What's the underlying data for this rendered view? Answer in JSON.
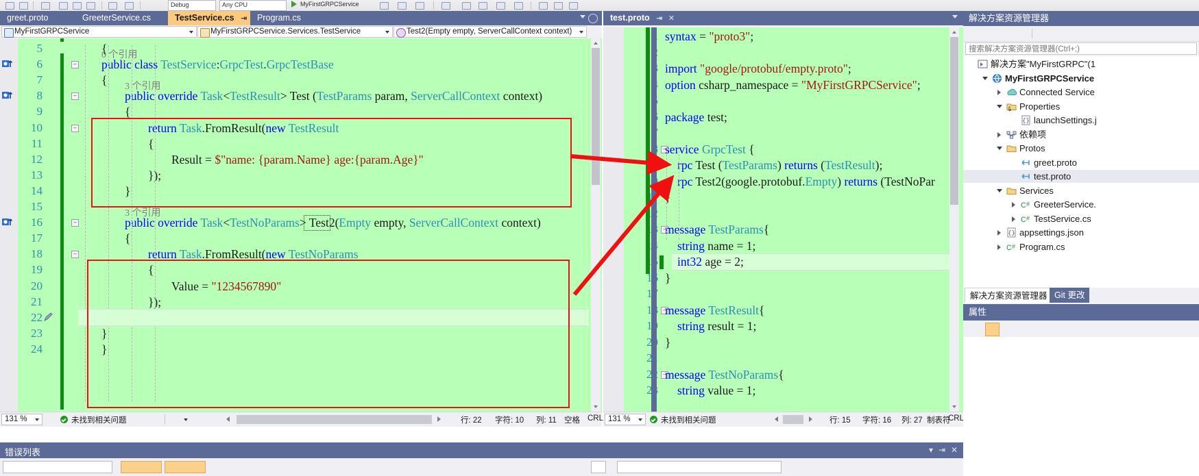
{
  "window": {
    "theme_accent": "#5b6a97",
    "editor_bg": "#b8ffb8"
  },
  "toolbar": {
    "config_value": "Debug",
    "platform_value": "Any CPU",
    "run_label": "MyFirstGRPCService"
  },
  "left_pane": {
    "tabs": [
      {
        "label": "greet.proto",
        "active": false
      },
      {
        "label": "GreeterService.cs",
        "active": false
      },
      {
        "label": "TestService.cs",
        "active": true,
        "pin": "⇥",
        "close": "✕"
      },
      {
        "label": "Program.cs",
        "active": false
      }
    ],
    "navbar": {
      "project": "MyFirstGRPCService",
      "type": "MyFirstGRPCService.Services.TestService",
      "member": "Test2(Empty empty, ServerCallContext context)"
    },
    "code_lines": [
      {
        "n": 5,
        "indent": 1,
        "text": "{"
      },
      {
        "n": 6,
        "indent": 1,
        "text": "public class TestService:GrpcTest.GrpcTestBase",
        "refs": "0 个引用",
        "fold": "-",
        "glyph": true
      },
      {
        "n": 7,
        "indent": 1,
        "text": "{"
      },
      {
        "n": 8,
        "indent": 2,
        "text": "public override Task<TestResult> Test (TestParams param, ServerCallContext context)",
        "refs": "3 个引用",
        "fold": "-",
        "glyph": true
      },
      {
        "n": 9,
        "indent": 2,
        "text": "{"
      },
      {
        "n": 10,
        "indent": 3,
        "text": "return Task.FromResult(new TestResult",
        "fold": "-"
      },
      {
        "n": 11,
        "indent": 3,
        "text": "{"
      },
      {
        "n": 12,
        "indent": 4,
        "text": "Result = $\"name: {param.Name} age:{param.Age}\""
      },
      {
        "n": 13,
        "indent": 3,
        "text": "});"
      },
      {
        "n": 14,
        "indent": 2,
        "text": "}"
      },
      {
        "n": 15,
        "indent": 2,
        "text": ""
      },
      {
        "n": 16,
        "indent": 2,
        "text": "public override Task<TestNoParams> Test2(Empty empty, ServerCallContext context)",
        "refs": "3 个引用",
        "fold": "-",
        "glyph": true
      },
      {
        "n": 17,
        "indent": 2,
        "text": "{"
      },
      {
        "n": 18,
        "indent": 3,
        "text": "return Task.FromResult(new TestNoParams",
        "fold": "-"
      },
      {
        "n": 19,
        "indent": 3,
        "text": "{"
      },
      {
        "n": 20,
        "indent": 4,
        "text": "Value = \"1234567890\""
      },
      {
        "n": 21,
        "indent": 3,
        "text": "});"
      },
      {
        "n": 22,
        "indent": 2,
        "text": "}"
      },
      {
        "n": 23,
        "indent": 1,
        "text": "}"
      },
      {
        "n": 24,
        "indent": 1,
        "text": "}"
      }
    ],
    "status": {
      "zoom": "131 %",
      "problems": "未找到相关问题",
      "line_label": "行: 22",
      "char_label": "字符: 10",
      "col_label": "列: 11",
      "spaces_label": "空格",
      "eol_label": "CRLF"
    }
  },
  "right_pane": {
    "tab": {
      "label": "test.proto",
      "pin": "⇥",
      "close": "✕"
    },
    "code_lines": [
      {
        "n": 1,
        "indent": 0,
        "text": "syntax = \"proto3\";"
      },
      {
        "n": 2,
        "indent": 0,
        "text": ""
      },
      {
        "n": 3,
        "indent": 0,
        "text": "import \"google/protobuf/empty.proto\";"
      },
      {
        "n": 4,
        "indent": 0,
        "text": "option csharp_namespace = \"MyFirstGRPCService\";"
      },
      {
        "n": 5,
        "indent": 0,
        "text": ""
      },
      {
        "n": 6,
        "indent": 0,
        "text": "package test;"
      },
      {
        "n": 7,
        "indent": 0,
        "text": ""
      },
      {
        "n": 8,
        "indent": 0,
        "text": "service GrpcTest {",
        "fold": "-"
      },
      {
        "n": 9,
        "indent": 1,
        "text": "rpc Test (TestParams) returns (TestResult);"
      },
      {
        "n": 10,
        "indent": 1,
        "text": "rpc Test2(google.protobuf.Empty) returns (TestNoPar"
      },
      {
        "n": 11,
        "indent": 0,
        "text": "}"
      },
      {
        "n": 12,
        "indent": 0,
        "text": ""
      },
      {
        "n": 13,
        "indent": 0,
        "text": "message TestParams{",
        "fold": "-"
      },
      {
        "n": 14,
        "indent": 1,
        "text": "string name = 1;"
      },
      {
        "n": 15,
        "indent": 1,
        "text": "int32 age = 2;",
        "current": true
      },
      {
        "n": 16,
        "indent": 0,
        "text": "}"
      },
      {
        "n": 17,
        "indent": 0,
        "text": ""
      },
      {
        "n": 18,
        "indent": 0,
        "text": "message TestResult{",
        "fold": "-"
      },
      {
        "n": 19,
        "indent": 1,
        "text": "string result = 1;"
      },
      {
        "n": 20,
        "indent": 0,
        "text": "}"
      },
      {
        "n": 21,
        "indent": 0,
        "text": ""
      },
      {
        "n": 22,
        "indent": 0,
        "text": "message TestNoParams{",
        "fold": "-"
      },
      {
        "n": 23,
        "indent": 1,
        "text": "string value = 1;"
      }
    ],
    "status": {
      "zoom": "131 %",
      "problems": "未找到相关问题",
      "line_label": "行: 15",
      "char_label": "字符: 16",
      "col_label": "列: 27",
      "tab_label": "制表符",
      "eol_label": "CRLF"
    }
  },
  "solution_explorer": {
    "title": "解决方案资源管理器",
    "search_placeholder": "搜索解决方案资源管理器(Ctrl+;)",
    "tree": [
      {
        "label": "解决方案\"MyFirstGRPC\"(1",
        "depth": 0,
        "icon": "solution-icon",
        "twisty": "none",
        "bold": false,
        "selected": false
      },
      {
        "label": "MyFirstGRPCService",
        "depth": 1,
        "icon": "project-icon",
        "twisty": "open",
        "bold": true,
        "selected": false
      },
      {
        "label": "Connected Service",
        "depth": 2,
        "icon": "connected-icon",
        "twisty": "closed",
        "bold": false,
        "selected": false
      },
      {
        "label": "Properties",
        "depth": 2,
        "icon": "folder-props-icon",
        "twisty": "open",
        "bold": false,
        "selected": false
      },
      {
        "label": "launchSettings.j",
        "depth": 3,
        "icon": "json-icon",
        "twisty": "none",
        "bold": false,
        "selected": false
      },
      {
        "label": "依赖项",
        "depth": 2,
        "icon": "deps-icon",
        "twisty": "closed",
        "bold": false,
        "selected": false
      },
      {
        "label": "Protos",
        "depth": 2,
        "icon": "folder-icon",
        "twisty": "open",
        "bold": false,
        "selected": false
      },
      {
        "label": "greet.proto",
        "depth": 3,
        "icon": "proto-icon",
        "twisty": "none",
        "bold": false,
        "selected": false
      },
      {
        "label": "test.proto",
        "depth": 3,
        "icon": "proto-icon",
        "twisty": "none",
        "bold": false,
        "selected": true
      },
      {
        "label": "Services",
        "depth": 2,
        "icon": "folder-icon",
        "twisty": "open",
        "bold": false,
        "selected": false
      },
      {
        "label": "GreeterService.",
        "depth": 3,
        "icon": "csharp-icon",
        "twisty": "closed",
        "bold": false,
        "selected": false
      },
      {
        "label": "TestService.cs",
        "depth": 3,
        "icon": "csharp-icon",
        "twisty": "closed",
        "bold": false,
        "selected": false
      },
      {
        "label": "appsettings.json",
        "depth": 2,
        "icon": "json-icon",
        "twisty": "closed",
        "bold": false,
        "selected": false
      },
      {
        "label": "Program.cs",
        "depth": 2,
        "icon": "csharp-icon",
        "twisty": "closed",
        "bold": false,
        "selected": false
      }
    ],
    "bottom_tabs": [
      {
        "label": "解决方案资源管理器",
        "active": true
      },
      {
        "label": "Git 更改",
        "active": false
      }
    ],
    "properties_title": "属性"
  },
  "error_list": {
    "title": "错误列表",
    "collapse": "▾",
    "pin": "⇥",
    "close": "✕"
  }
}
